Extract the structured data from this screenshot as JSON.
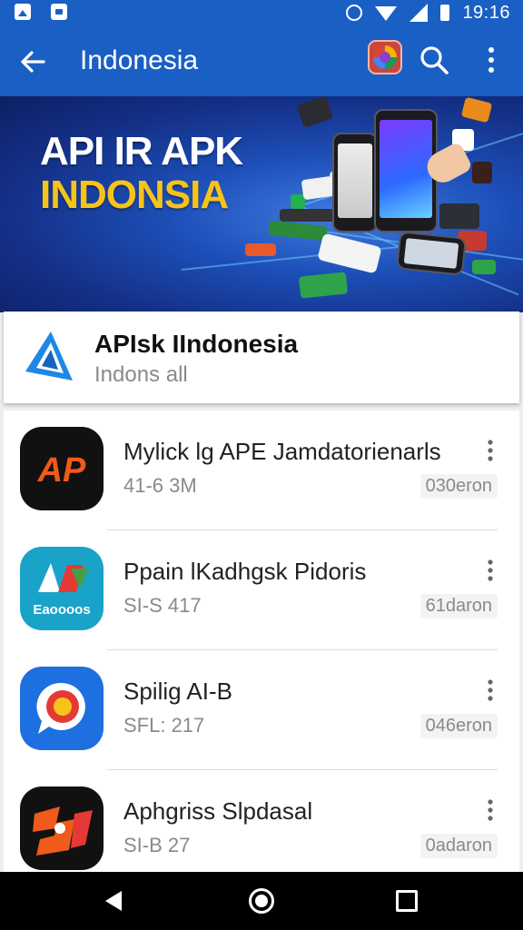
{
  "status_bar": {
    "time": "19:16",
    "icons": [
      "image-notification-icon",
      "bag-notification-icon",
      "alarm-icon",
      "wifi-icon",
      "signal-icon",
      "battery-icon"
    ]
  },
  "app_bar": {
    "title": "Indonesia",
    "back_icon": "arrow-left-icon",
    "actions": [
      "app-badge-icon",
      "search-icon",
      "overflow-menu-icon"
    ],
    "color": "#1a5fc4"
  },
  "banner": {
    "line1": "API IR APK",
    "line2": "INDONSIA",
    "line1_color": "#ffffff",
    "line2_color": "#f6c31a"
  },
  "featured": {
    "title": "APIsk IIndonesia",
    "subtitle": "Indons all",
    "logo_icon": "triangle-logo-icon",
    "logo_color": "#1e88e5"
  },
  "apps": [
    {
      "title": "Mylick lg APE Jamdatorienarls",
      "meta": "41-6 3M",
      "size": "030eron",
      "icon": "ap-logo-icon",
      "icon_bg": "#111111"
    },
    {
      "title": "Ppain lKadhgsk Pidoris",
      "meta": "SI-S 417",
      "size": "61daron",
      "icon": "apk-logo-icon",
      "icon_bg": "#1aa3c9",
      "icon_label": "Eaoooos"
    },
    {
      "title": "Spilig AI-B",
      "meta": "SFL: 217",
      "size": "046eron",
      "icon": "chat-bubble-icon",
      "icon_bg": "#1e6fe0"
    },
    {
      "title": "Aphgriss Slpdasal",
      "meta": "SI-B 27",
      "size": "0adaron",
      "icon": "sp-logo-icon",
      "icon_bg": "#111111"
    }
  ],
  "nav_bar": {
    "buttons": [
      "nav-back-icon",
      "nav-home-icon",
      "nav-recents-icon"
    ]
  }
}
